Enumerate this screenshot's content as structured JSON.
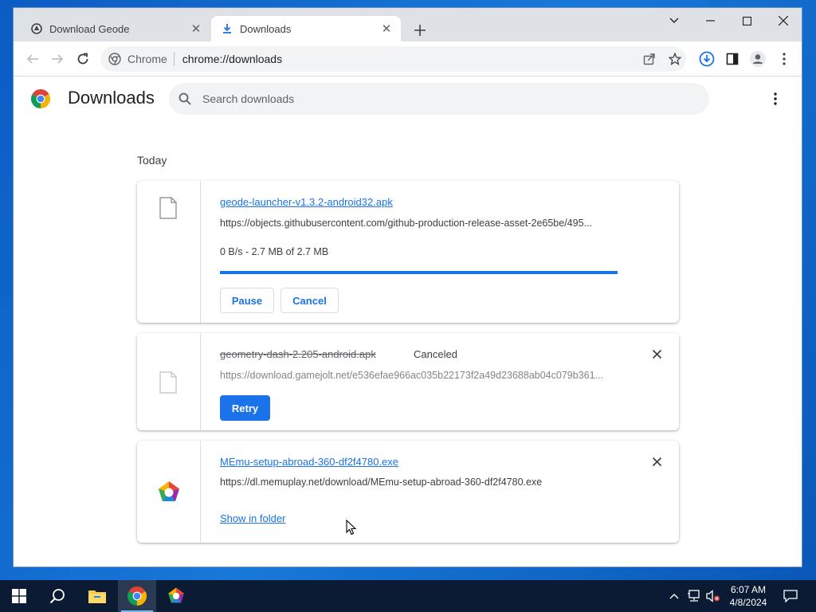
{
  "tabs": [
    {
      "title": "Download Geode",
      "icon": "geode-icon",
      "active": false
    },
    {
      "title": "Downloads",
      "icon": "download-arrow-icon",
      "active": true
    }
  ],
  "omnibox": {
    "site": "Chrome",
    "url": "chrome://downloads"
  },
  "page": {
    "title": "Downloads",
    "search_placeholder": "Search downloads",
    "section_date": "Today"
  },
  "downloads": [
    {
      "file_name": "geode-launcher-v1.3.2-android32.apk",
      "url": "https://objects.githubusercontent.com/github-production-release-asset-2e65be/495...",
      "progress_text": "0 B/s - 2.7 MB of 2.7 MB",
      "progress_fraction": 1.0,
      "buttons": {
        "pause": "Pause",
        "cancel": "Cancel"
      }
    },
    {
      "file_name": "geometry-dash-2.205-android.apk",
      "status": "Canceled",
      "url": "https://download.gamejolt.net/e536efae966ac035b22173f2a49d23688ab04c079b361...",
      "buttons": {
        "retry": "Retry"
      }
    },
    {
      "file_name": "MEmu-setup-abroad-360-df2f4780.exe",
      "url": "https://dl.memuplay.net/download/MEmu-setup-abroad-360-df2f4780.exe",
      "link": "Show in folder"
    }
  ],
  "taskbar": {
    "time": "6:07 AM",
    "date": "4/8/2024"
  },
  "colors": {
    "accent": "#1a73e8",
    "taskbar": "#0b1b33",
    "tabstrip": "#dee1e6"
  }
}
